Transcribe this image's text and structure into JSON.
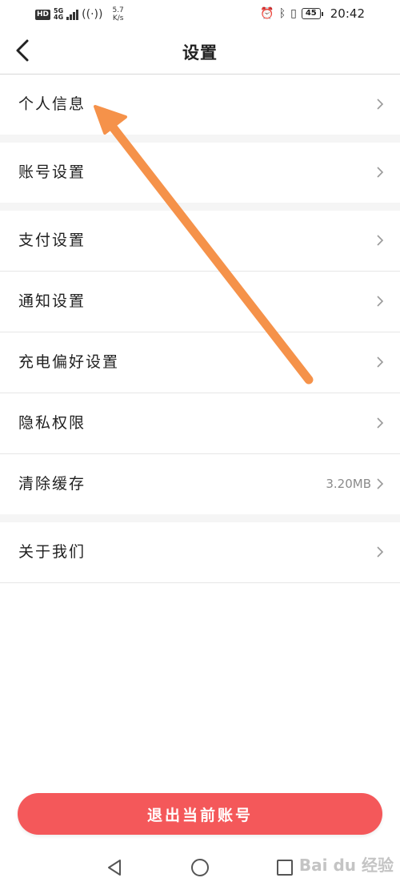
{
  "status_bar": {
    "hd_badge": "HD",
    "network": "5G",
    "network_sub": "4G",
    "speed_value": "5.7",
    "speed_unit": "K/s",
    "battery": "45",
    "time": "20:42"
  },
  "header": {
    "title": "设置"
  },
  "groups": [
    {
      "items": [
        {
          "label": "个人信息"
        }
      ]
    },
    {
      "items": [
        {
          "label": "账号设置"
        }
      ]
    },
    {
      "items": [
        {
          "label": "支付设置"
        },
        {
          "label": "通知设置"
        },
        {
          "label": "充电偏好设置"
        },
        {
          "label": "隐私权限"
        },
        {
          "label": "清除缓存",
          "value": "3.20MB"
        }
      ]
    },
    {
      "items": [
        {
          "label": "关于我们"
        }
      ]
    }
  ],
  "logout_label": "退出当前账号",
  "watermark": "Bai du 经验",
  "colors": {
    "accent": "#f4585a",
    "arrow": "#f5924a",
    "divider": "#e6e6e6",
    "group_gap": "#f5f5f5"
  },
  "icons": {
    "back": "chevron-left-icon",
    "row": "chevron-right-icon",
    "nav_back": "triangle-back-icon",
    "nav_home": "circle-home-icon",
    "nav_recent": "square-recent-icon"
  }
}
